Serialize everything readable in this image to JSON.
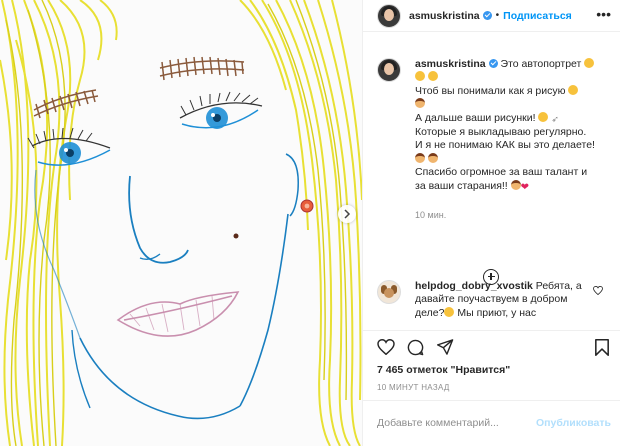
{
  "header": {
    "username": "asmuskristina",
    "follow_label": "Подписаться",
    "more_label": "•••"
  },
  "caption": {
    "username": "asmuskristina",
    "line1": "Это автопортрет",
    "line2": "Чтоб вы понимали как я рисую",
    "line3": "А дальше ваши рисунки!",
    "line4": "Которые я выкладываю регулярно.",
    "line5": "И я не понимаю КАК вы это делаете!",
    "line6": "Спасибо огромное за ваш талант и",
    "line7": "за ваши старания!!",
    "time": "10 мин."
  },
  "comment": {
    "username": "helpdog_dobry_xvostik",
    "text_part1": "Ребята, а давайте поучаствуем в добром деле?",
    "text_part2": " Мы приют, у нас"
  },
  "likes": {
    "text": "7 465 отметок \"Нравится\""
  },
  "ago": "10 МИНУТ НАЗАД",
  "add_comment": {
    "placeholder": "Добавьте комментарий...",
    "publish_label": "Опубликовать"
  },
  "colors": {
    "accent": "#0095f6",
    "publish_disabled": "#b2dffc",
    "hair": "#e8df2a",
    "eye_blue": "#1e8fd6",
    "brow_brown": "#8a5a3c",
    "lips_pink": "#c98fae",
    "outline_blue": "#1a7fc0"
  },
  "icons": {
    "heart": "heart-icon",
    "comment": "comment-icon",
    "share": "share-icon",
    "bookmark": "bookmark-icon",
    "next": "chevron-right-icon",
    "more": "more-icon",
    "add": "plus-circle-icon"
  }
}
